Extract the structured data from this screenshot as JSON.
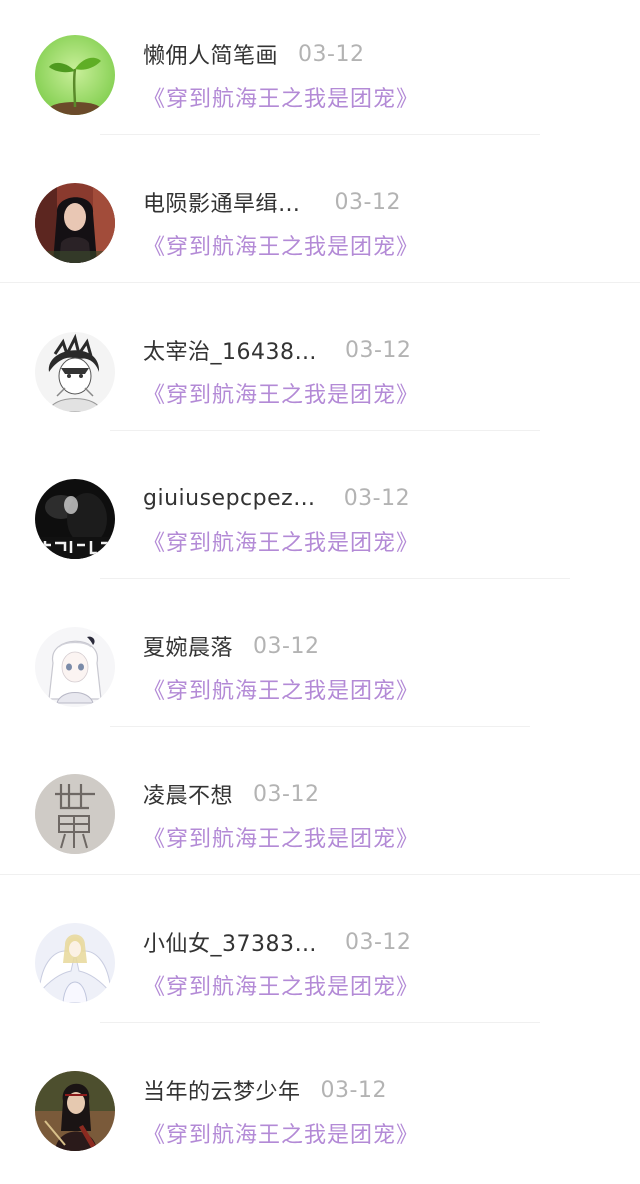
{
  "items": [
    {
      "user": "懒佣人简笔画",
      "date": "03-12",
      "book": "《穿到航海王之我是团宠》",
      "avatar": "sprout-avatar"
    },
    {
      "user": "电陨影通旱缉…",
      "date": "03-12",
      "book": "《穿到航海王之我是团宠》",
      "avatar": "long-hair-girl-avatar"
    },
    {
      "user": "太宰治_16438…",
      "date": "03-12",
      "book": "《穿到航海王之我是团宠》",
      "avatar": "anime-boy-avatar"
    },
    {
      "user": "giuiusepcpez…",
      "date": "03-12",
      "book": "《穿到航海王之我是团宠》",
      "avatar": "dark-portrait-avatar"
    },
    {
      "user": "夏婉晨落",
      "date": "03-12",
      "book": "《穿到航海王之我是团宠》",
      "avatar": "white-hair-anime-avatar"
    },
    {
      "user": "凌晨不想",
      "date": "03-12",
      "book": "《穿到航海王之我是团宠》",
      "avatar": "world-text-avatar"
    },
    {
      "user": "小仙女_37383…",
      "date": "03-12",
      "book": "《穿到航海王之我是团宠》",
      "avatar": "angel-avatar"
    },
    {
      "user": "当年的云梦少年",
      "date": "03-12",
      "book": "《穿到航海王之我是团宠》",
      "avatar": "ancient-hero-avatar"
    }
  ],
  "colors": {
    "username": "#333333",
    "date": "#b3b3b3",
    "book": "#b38ad6",
    "divider": "#f0f0f0"
  }
}
